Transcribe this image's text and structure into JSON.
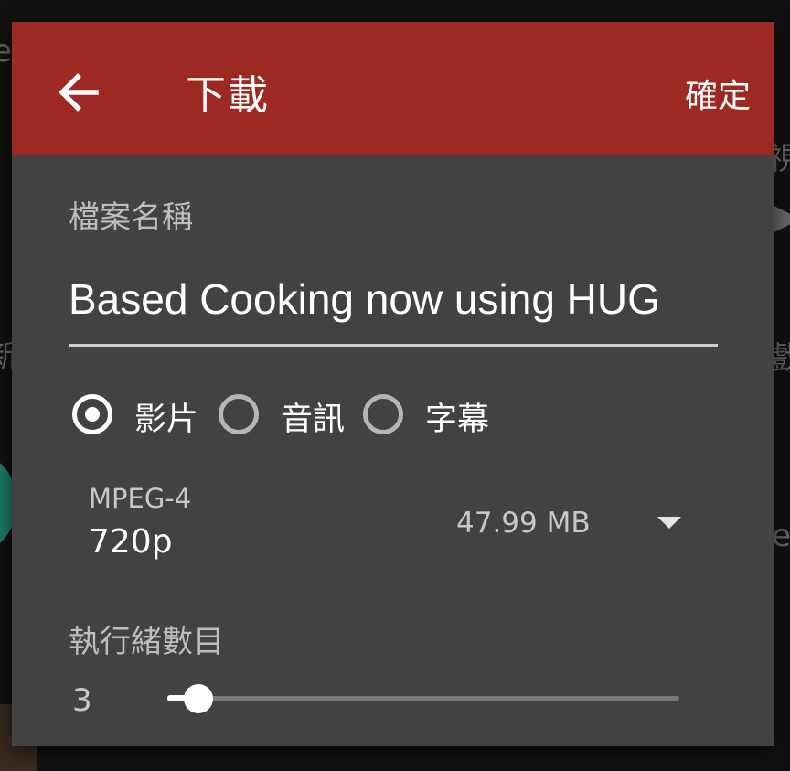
{
  "toolbar": {
    "title": "下載",
    "confirm_label": "確定",
    "back_icon": "arrow-left-icon",
    "color": "#9c2a23"
  },
  "filename": {
    "label": "檔案名稱",
    "value": "Based Cooking now using HUG"
  },
  "download_type": {
    "options": [
      {
        "label": "影片",
        "selected": true
      },
      {
        "label": "音訊",
        "selected": false
      },
      {
        "label": "字幕",
        "selected": false
      }
    ]
  },
  "format": {
    "container": "MPEG-4",
    "resolution": "720p",
    "size": "47.99 MB",
    "dropdown_icon": "triangle-down-icon"
  },
  "threads": {
    "label": "執行緒數目",
    "value": "3",
    "slider_fraction": 0.06
  },
  "dialog_background": "#424242"
}
